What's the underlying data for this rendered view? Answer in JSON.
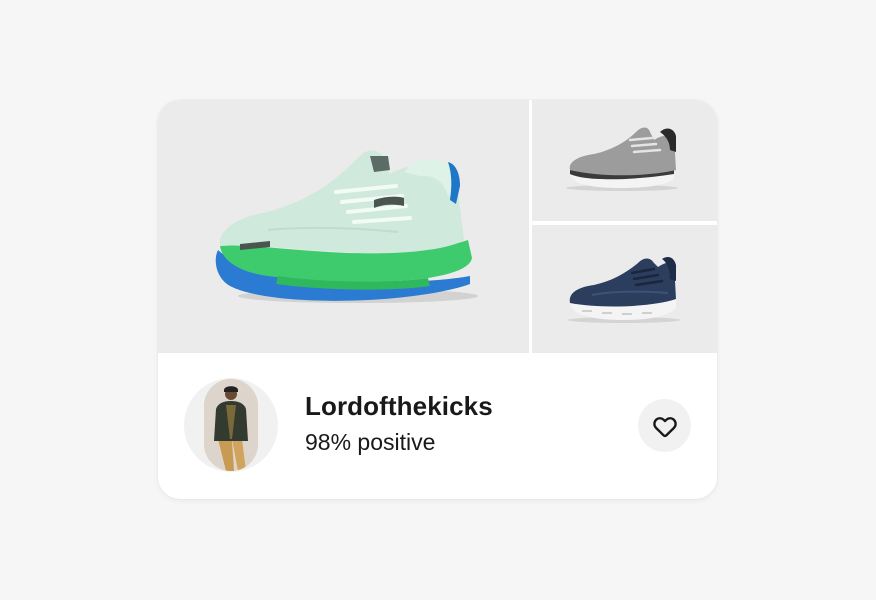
{
  "gallery": {
    "images": [
      {
        "icon": "shoe-mint-green-icon",
        "alt": "Mint green running shoe"
      },
      {
        "icon": "shoe-grey-icon",
        "alt": "Grey running shoe"
      },
      {
        "icon": "shoe-navy-icon",
        "alt": "Navy running shoe"
      }
    ]
  },
  "seller": {
    "name": "Lordofthekicks",
    "rating": "98% positive",
    "avatar_icon": "seller-avatar-photo"
  },
  "actions": {
    "favorite_icon": "heart-icon",
    "favorite_label": "Save seller"
  },
  "colors": {
    "page_bg": "#f6f6f6",
    "card_bg": "#ffffff",
    "tile_bg": "#ebebeb",
    "text": "#191919"
  }
}
